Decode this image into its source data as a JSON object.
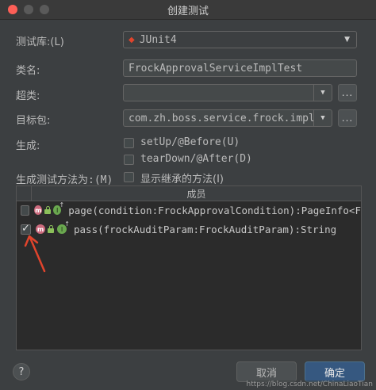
{
  "window": {
    "title": "创建测试"
  },
  "form": {
    "test_library_label": "测试库:(L)",
    "test_library_value": "JUnit4",
    "class_name_label": "类名:",
    "class_name_value": "FrockApprovalServiceImplTest",
    "superclass_label": "超类:",
    "superclass_value": "",
    "target_package_label": "目标包:",
    "target_package_value": "com.zh.boss.service.frock.impl",
    "generate_label": "生成:",
    "setup_label": "setUp/@Before(U)",
    "teardown_label": "tearDown/@After(D)",
    "generate_methods_label": "生成测试方法为:(M)",
    "show_inherited_label": "显示继承的方法(I)",
    "browse_label": "..."
  },
  "table": {
    "header_member": "成员",
    "rows": [
      {
        "text": "page(condition:FrockApprovalCondition):PageInfo<F",
        "checked": false
      },
      {
        "text": "pass(frockAuditParam:FrockAuditParam):String",
        "checked": true
      }
    ]
  },
  "footer": {
    "help_label": "?",
    "cancel_label": "取消",
    "ok_label": "确定",
    "watermark": "https://blog.csdn.net/ChinaLiaoTian"
  },
  "colors": {
    "background": "#3c3f41",
    "accent_button": "#365880",
    "arrow": "#e0442c",
    "junit_icon": "#e0442c"
  },
  "icons": [
    "junit-icon",
    "method-icon",
    "lock-icon",
    "override-icon",
    "dropdown-arrow-icon",
    "help-icon",
    "red-arrow-annotation"
  ]
}
